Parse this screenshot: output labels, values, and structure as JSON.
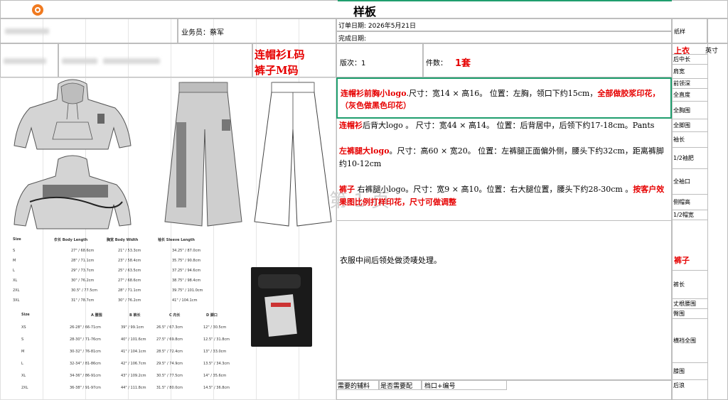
{
  "sheet": {
    "title": "样板",
    "sales_label": "业务员：蔡军",
    "order_date": "订单日期: 2026年5月21日",
    "finish_date": "完成日期:",
    "version": "版次：1",
    "pieces_label": "件数：",
    "pieces_value": "1套",
    "paper_sample": "纸样",
    "big_title_1": "连帽衫L码",
    "big_title_2": "裤子M码",
    "page_watermark": "第 1 页"
  },
  "notes": {
    "n1_red": "连帽衫前胸小logo",
    "n1_rest": ".尺寸：宽14 × 高16。 位置：左胸，领口下约15cm，",
    "n1_red2": "全部做胶浆印花，（灰色做黑色印花）",
    "n2_red": "连帽衫",
    "n2_rest": "后背大logo 。 尺寸：宽44 × 高14。 位置：后背居中，后领下约17-18cm。Pants",
    "n3_red": "左裤腿大logo",
    "n3_rest": "。尺寸：高60 × 宽20。 位置：左裤腿正面偏外侧，腰头下约32cm，距离裤脚约10-12cm",
    "n4_red": "裤子",
    "n4_rest": " 右裤腿小logo。尺寸：宽9 × 高10。位置：右大腿位置，腰头下约28-30cm 。",
    "n4_red2": "按客户效果图比例打样印花，尺寸可做调整",
    "n5": "衣服中间后领处做烫唛处理。"
  },
  "right_panel": {
    "top_label": "上衣",
    "unit": "英寸",
    "top_items": [
      "后中长",
      "肩宽",
      "前领深",
      "全直度",
      "全胸围",
      "全脚围",
      "袖长",
      "1/2袖肥",
      "全袖口",
      "侧帽高",
      "1/2帽宽"
    ],
    "pants_label": "裤子",
    "pants_items": [
      "裤长",
      "丈根腰围",
      "臀围",
      "横裆全围",
      "膝围",
      "后浪"
    ]
  },
  "bottom_row": {
    "c1": "需要的辅料",
    "c2": "是否需要配",
    "c3": "档口+编号"
  },
  "size_table_1": {
    "headers": [
      "Size",
      "衣长 Body Length",
      "胸宽 Body Width",
      "袖长 Sleeve Length"
    ],
    "rows": [
      [
        "S",
        "27\" / 68.6cm",
        "21\" / 53.3cm",
        "34.25\" / 87.0cm"
      ],
      [
        "M",
        "28\" / 71.1cm",
        "23\" / 58.4cm",
        "35.75\" / 90.8cm"
      ],
      [
        "L",
        "29\" / 73.7cm",
        "25\" / 63.5cm",
        "37.25\" / 94.6cm"
      ],
      [
        "XL",
        "30\" / 76.2cm",
        "27\" / 68.6cm",
        "38.75\" / 98.4cm"
      ],
      [
        "2XL",
        "30.5\" / 77.5cm",
        "28\" / 71.1cm",
        "39.75\" / 101.0cm"
      ],
      [
        "3XL",
        "31\" / 78.7cm",
        "30\" / 76.2cm",
        "41\" / 104.1cm"
      ]
    ]
  },
  "size_table_2": {
    "headers": [
      "Size",
      "A 腰围",
      "B 裤长",
      "C 内长",
      "D 脚口"
    ],
    "rows": [
      [
        "XS",
        "26-28\" / 66-71cm",
        "39\" / 99.1cm",
        "26.5\" / 67.3cm",
        "12\" / 30.5cm"
      ],
      [
        "S",
        "28-30\" / 71-76cm",
        "40\" / 101.6cm",
        "27.5\" / 69.8cm",
        "12.5\" / 31.8cm"
      ],
      [
        "M",
        "30-32\" / 76-81cm",
        "41\" / 104.1cm",
        "28.5\" / 72.4cm",
        "13\" / 33.0cm"
      ],
      [
        "L",
        "32-34\" / 81-86cm",
        "42\" / 106.7cm",
        "29.5\" / 74.9cm",
        "13.5\" / 34.3cm"
      ],
      [
        "XL",
        "34-36\" / 86-91cm",
        "43\" / 109.2cm",
        "30.5\" / 77.5cm",
        "14\" / 35.6cm"
      ],
      [
        "2XL",
        "36-38\" / 91-97cm",
        "44\" / 111.8cm",
        "31.5\" / 80.0cm",
        "14.5\" / 36.8cm"
      ]
    ]
  },
  "colors": {
    "accent_green": "#1f9e6e",
    "red": "#e60000",
    "logo_orange": "#f07a20"
  }
}
